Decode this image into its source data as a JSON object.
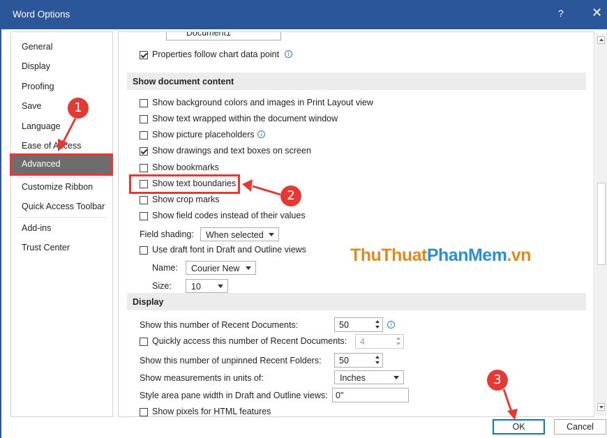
{
  "window": {
    "title": "Word Options",
    "help": "?",
    "close": "✕"
  },
  "sidebar": {
    "items": [
      {
        "label": "General"
      },
      {
        "label": "Display"
      },
      {
        "label": "Proofing"
      },
      {
        "label": "Save"
      },
      {
        "label": "Language"
      },
      {
        "label": "Ease of Access"
      },
      {
        "label": "Advanced"
      },
      {
        "label": "Customize Ribbon"
      },
      {
        "label": "Quick Access Toolbar"
      },
      {
        "label": "Add-ins"
      },
      {
        "label": "Trust Center"
      }
    ],
    "selected": "Advanced"
  },
  "content": {
    "chart_row": {
      "dropdown_value": "Document1"
    },
    "properties_follow": {
      "label": "Properties follow chart data point",
      "checked": true
    },
    "show_document_content": {
      "header": "Show document content",
      "items": [
        {
          "label": "Show background colors and images in Print Layout view",
          "checked": false
        },
        {
          "label": "Show text wrapped within the document window",
          "checked": false
        },
        {
          "label": "Show picture placeholders",
          "checked": false
        },
        {
          "label": "Show drawings and text boxes on screen",
          "checked": true
        },
        {
          "label": "Show bookmarks",
          "checked": false
        },
        {
          "label": "Show text boundaries",
          "checked": false
        },
        {
          "label": "Show crop marks",
          "checked": false
        },
        {
          "label": "Show field codes instead of their values",
          "checked": false
        }
      ],
      "field_shading": {
        "label": "Field shading:",
        "value": "When selected"
      },
      "draft_font": {
        "label": "Use draft font in Draft and Outline views",
        "checked": false
      },
      "name": {
        "label": "Name:",
        "value": "Courier New"
      },
      "size": {
        "label": "Size:",
        "value": "10"
      }
    },
    "display": {
      "header": "Display",
      "recent_docs": {
        "label": "Show this number of Recent Documents:",
        "value": "50"
      },
      "quick_access": {
        "label": "Quickly access this number of Recent Documents:",
        "value": "4",
        "checked": false
      },
      "unpinned_folders": {
        "label": "Show this number of unpinned Recent Folders:",
        "value": "50"
      },
      "measurements": {
        "label": "Show measurements in units of:",
        "value": "Inches"
      },
      "style_area": {
        "label": "Style area pane width in Draft and Outline views:",
        "value": "0\""
      },
      "pixels_html": {
        "label": "Show pixels for HTML features",
        "checked": false
      }
    }
  },
  "buttons": {
    "ok": "OK",
    "cancel": "Cancel"
  },
  "annotations": {
    "badge1": "1",
    "badge2": "2",
    "badge3": "3"
  },
  "watermark": {
    "part1": "ThuThuat",
    "part2": "PhanMem",
    "part3": ".vn"
  },
  "colors": {
    "title_bar": "#2b579a",
    "selected_nav": "#6d6d6d",
    "annotation_red": "#e53935",
    "section_header": "#ececec"
  }
}
